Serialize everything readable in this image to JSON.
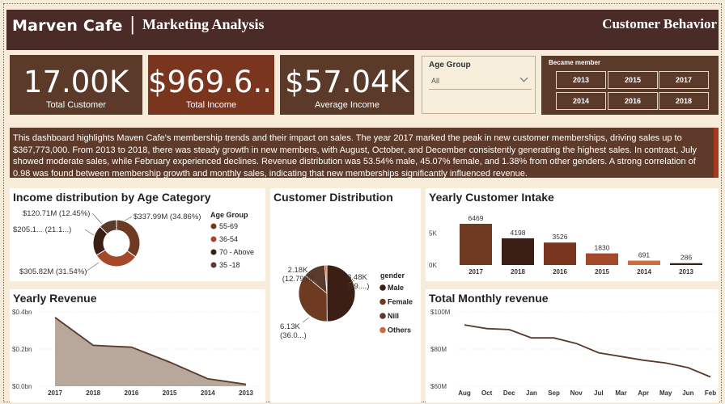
{
  "header": {
    "brand": "Marven Cafe",
    "separator": "|",
    "subtitle": "Marketing Analysis",
    "right_title": "Customer Behavior"
  },
  "kpis": [
    {
      "value": "17.00K",
      "label": "Total Customer",
      "color": "#5c3a29"
    },
    {
      "value": "$969.6...",
      "label": "Total Income",
      "color": "#7a351f"
    },
    {
      "value": "$57.04K",
      "label": "Average Income",
      "color": "#5c3a29"
    }
  ],
  "age_slicer": {
    "title": "Age Group",
    "selected": "All"
  },
  "member_slicer": {
    "title": "Became member",
    "years": [
      "2013",
      "2015",
      "2017",
      "2014",
      "2016",
      "2018"
    ]
  },
  "description": "This dashboard highlights Maven Cafe's membership trends and their impact on sales. The year 2017 marked the peak in new customer memberships, driving sales up to $367,773,000. From 2013 to 2018, there was steady growth in new members, with August, October, and December consistently generating the highest sales. In contrast, July showed moderate sales, while February experienced declines. Revenue distribution was 53.54% male, 45.07% female, and 1.38% from other genders. A strong correlation of 0.98 was found between membership growth and monthly sales, indicating that new memberships significantly influenced revenue.",
  "colors": {
    "dark_brown": "#3b1f14",
    "brown": "#6e3b22",
    "rust": "#a44a2a",
    "orange": "#d06b3e",
    "header": "#4a2b28"
  },
  "chart_data": [
    {
      "type": "pie",
      "variant": "donut",
      "title": "Income distribution by Age Category",
      "legend_title": "Age Group",
      "categories": [
        "55-69",
        "36-54",
        "70 - Above",
        "35 -18"
      ],
      "values": [
        337.99,
        305.82,
        205.1,
        120.71
      ],
      "labels": [
        "$337.99M (34.86%)",
        "$305.82M (31.54%)",
        "$205.1... (21.1...)",
        "$120.71M (12.45%)"
      ],
      "colors": [
        "#6e3b22",
        "#a44a2a",
        "#3b1f14",
        "#5a3a2a"
      ]
    },
    {
      "type": "pie",
      "title": "Customer Distribution",
      "legend_title": "gender",
      "categories": [
        "Male",
        "Female",
        "Nill",
        "Others"
      ],
      "values": [
        8.48,
        6.13,
        2.18,
        0.21
      ],
      "labels": [
        "8.48K (49....)",
        "6.13K (36.0...)",
        "2.18K (12.79%)",
        ""
      ],
      "colors": [
        "#3b1f14",
        "#6e3b22",
        "#5a3a2a",
        "#d06b3e"
      ]
    },
    {
      "type": "bar",
      "title": "Yearly Customer Intake",
      "categories": [
        "2017",
        "2018",
        "2016",
        "2015",
        "2014",
        "2013"
      ],
      "values": [
        6469,
        4198,
        3526,
        1830,
        691,
        286
      ],
      "colors": [
        "#6e3b22",
        "#3b1f14",
        "#7a351f",
        "#a44a2a",
        "#d06b3e",
        "#3b1f14"
      ],
      "ytick_labels": [
        "0K",
        "5K"
      ],
      "ytick_values": [
        0,
        5000
      ],
      "ylim": [
        0,
        7000
      ]
    },
    {
      "type": "area",
      "title": "Yearly Revenue",
      "categories": [
        "2017",
        "2018",
        "2016",
        "2015",
        "2014",
        "2013"
      ],
      "values": [
        0.37,
        0.22,
        0.21,
        0.13,
        0.04,
        0.01
      ],
      "ytick_labels": [
        "$0.0bn",
        "$0.2bn",
        "$0.4bn"
      ],
      "ytick_values": [
        0,
        0.2,
        0.4
      ],
      "ylim": [
        0,
        0.4
      ]
    },
    {
      "type": "line",
      "title": "Total Monthly revenue",
      "categories": [
        "Aug",
        "Oct",
        "Dec",
        "Jan",
        "Sep",
        "Nov",
        "Jul",
        "Mar",
        "Apr",
        "May",
        "Jun",
        "Feb"
      ],
      "values": [
        93,
        91,
        90.5,
        86,
        86,
        83,
        78,
        76,
        74,
        72.5,
        70,
        65
      ],
      "ytick_labels": [
        "$60M",
        "$80M",
        "$100M"
      ],
      "ytick_values": [
        60,
        80,
        100
      ],
      "ylim": [
        60,
        100
      ]
    }
  ]
}
